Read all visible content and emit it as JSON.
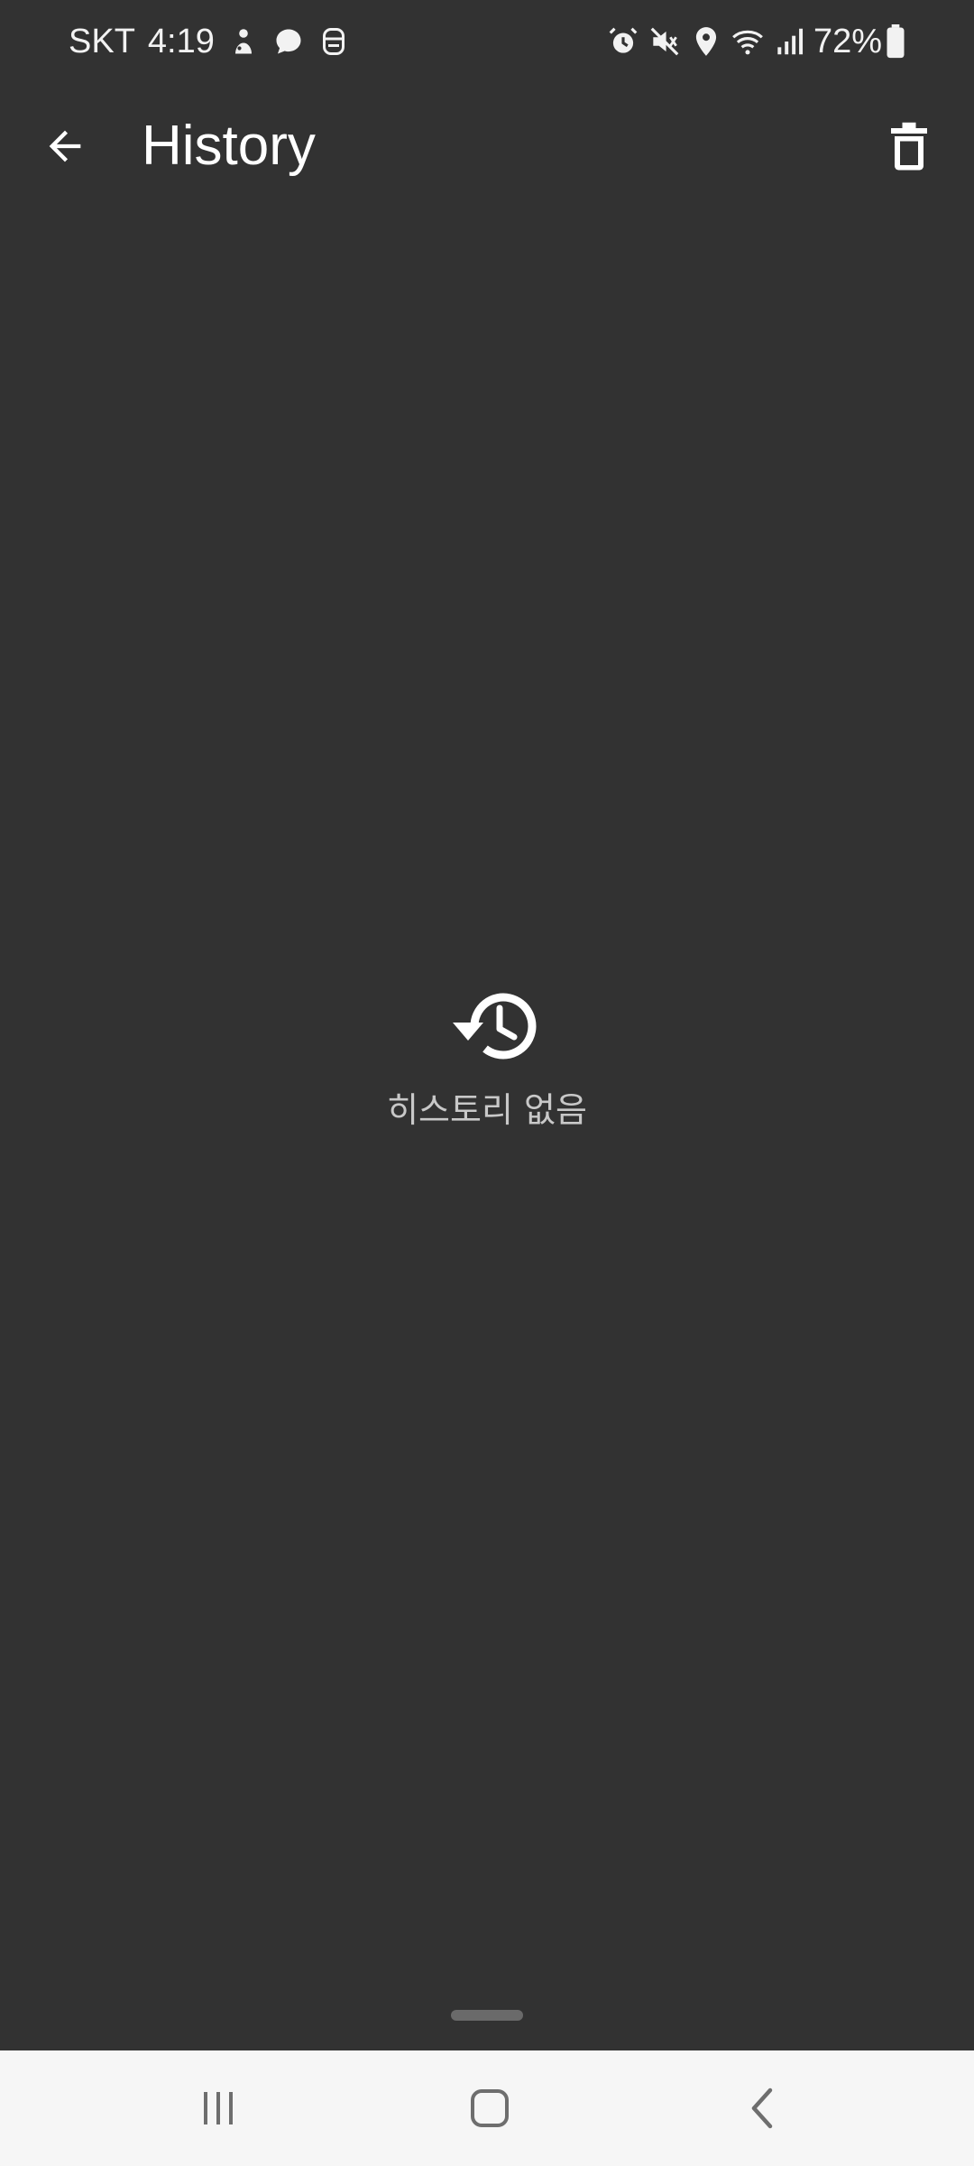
{
  "status_bar": {
    "carrier": "SKT",
    "time": "4:19",
    "notification_icons": [
      "person-notification-icon",
      "chat-bubble-icon",
      "robot-notification-icon"
    ],
    "system_icons": [
      "alarm-icon",
      "mute-icon",
      "location-icon",
      "wifi-icon",
      "signal-icon"
    ],
    "battery_percent": "72%"
  },
  "app_bar": {
    "title": "History",
    "back_icon": "arrow-back-icon",
    "delete_icon": "trash-icon"
  },
  "empty_state": {
    "icon": "history-icon",
    "message": "히스토리 없음"
  },
  "nav_bar": {
    "buttons": [
      "recents",
      "home",
      "back"
    ]
  },
  "colors": {
    "background": "#323232",
    "text_primary": "#ffffff",
    "text_secondary": "#c8c8c8",
    "nav_background": "#f6f6f6"
  }
}
